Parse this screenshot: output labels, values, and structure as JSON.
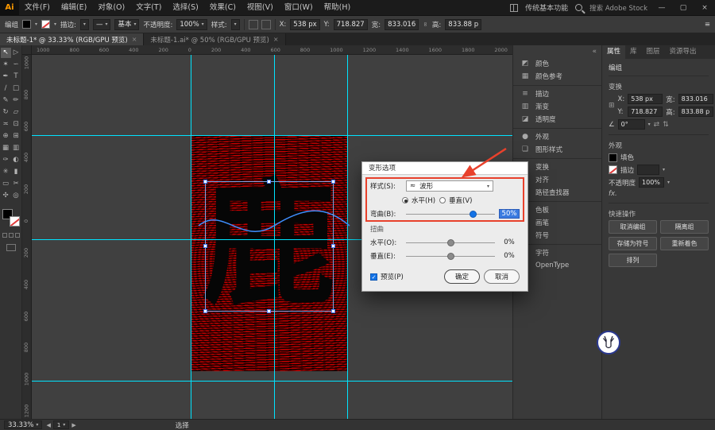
{
  "colors": {
    "accent_blue": "#1473e6",
    "guide_cyan": "#00e4ff",
    "artwork_red": "#c40000",
    "annotation_red": "#e8412c",
    "selection_blue": "#7aa7e8"
  },
  "icons": {
    "caret": "▾",
    "arrow_left": "◀",
    "arrow_right": "▶",
    "close": "×",
    "minimize": "—",
    "maximize": "▢",
    "collapse": "«",
    "check": "✓",
    "wave": "≈",
    "link": "∞",
    "angle": "∠",
    "ref_point": "⊞",
    "flip_h": "⇄",
    "flip_v": "⇅",
    "menu_burger": "≡"
  },
  "app": {
    "logo": "Ai",
    "menus": [
      {
        "name": "menu-file",
        "label": "文件(F)"
      },
      {
        "name": "menu-edit",
        "label": "编辑(E)"
      },
      {
        "name": "menu-object",
        "label": "对象(O)"
      },
      {
        "name": "menu-type",
        "label": "文字(T)"
      },
      {
        "name": "menu-select",
        "label": "选择(S)"
      },
      {
        "name": "menu-effect",
        "label": "效果(C)"
      },
      {
        "name": "menu-view",
        "label": "视图(V)"
      },
      {
        "name": "menu-window",
        "label": "窗口(W)"
      },
      {
        "name": "menu-help",
        "label": "帮助(H)"
      }
    ],
    "workspace": "传统基本功能",
    "stock_search": "搜索 Adobe Stock"
  },
  "control_bar": {
    "selection_label": "编组",
    "stroke_label": "描边:",
    "profile": "—",
    "brush": "基本",
    "opacity_label": "不透明度:",
    "opacity": "100%",
    "style_label": "样式:",
    "x_label": "X:",
    "x": "538 px",
    "y_label": "Y:",
    "y": "718.827",
    "w_label": "宽:",
    "w": "833.016",
    "h_label": "高:",
    "h": "833.88 p"
  },
  "tabs": [
    {
      "name": "tab-untitled-1",
      "title": "未标题-1* @ 33.33% (RGB/GPU 预览)",
      "active": true
    },
    {
      "name": "tab-untitled-1-ai",
      "title": "未标题-1.ai* @ 50% (RGB/GPU 预览)",
      "active": false
    }
  ],
  "toolbar": {
    "tools": [
      {
        "name": "selection-tool",
        "glyph": "↖",
        "active": true
      },
      {
        "name": "direct-selection-tool",
        "glyph": "▷"
      },
      {
        "name": "magic-wand-tool",
        "glyph": "✶"
      },
      {
        "name": "lasso-tool",
        "glyph": "∽"
      },
      {
        "name": "pen-tool",
        "glyph": "✒"
      },
      {
        "name": "type-tool",
        "glyph": "T"
      },
      {
        "name": "line-segment-tool",
        "glyph": "∕"
      },
      {
        "name": "rectangle-tool",
        "glyph": "□"
      },
      {
        "name": "paintbrush-tool",
        "glyph": "✎"
      },
      {
        "name": "pencil-tool",
        "glyph": "✏"
      },
      {
        "name": "rotate-tool",
        "glyph": "↻"
      },
      {
        "name": "scale-tool",
        "glyph": "▱"
      },
      {
        "name": "width-tool",
        "glyph": "≍"
      },
      {
        "name": "free-transform-tool",
        "glyph": "⊡"
      },
      {
        "name": "shape-builder-tool",
        "glyph": "⊕"
      },
      {
        "name": "perspective-grid-tool",
        "glyph": "⊞"
      },
      {
        "name": "mesh-tool",
        "glyph": "▦"
      },
      {
        "name": "gradient-tool",
        "glyph": "▥"
      },
      {
        "name": "eyedropper-tool",
        "glyph": "✑"
      },
      {
        "name": "blend-tool",
        "glyph": "◐"
      },
      {
        "name": "symbol-sprayer-tool",
        "glyph": "✳"
      },
      {
        "name": "column-graph-tool",
        "glyph": "▮"
      },
      {
        "name": "artboard-tool",
        "glyph": "▭"
      },
      {
        "name": "slice-tool",
        "glyph": "✂"
      },
      {
        "name": "hand-tool",
        "glyph": "✣"
      },
      {
        "name": "zoom-tool",
        "glyph": "◎"
      }
    ]
  },
  "rulers": {
    "top": [
      "1000",
      "800",
      "600",
      "400",
      "200",
      "0",
      "200",
      "400",
      "600",
      "800",
      "1000",
      "1200",
      "1400",
      "1600",
      "1800",
      "2000"
    ],
    "left": [
      "1000",
      "800",
      "600",
      "400",
      "200",
      "0",
      "200",
      "400",
      "600",
      "800",
      "1000",
      "1200"
    ]
  },
  "canvas": {
    "artwork_char": "鹿"
  },
  "dialog": {
    "title": "变形选项",
    "style_label": "样式(S):",
    "style_value": "波形",
    "radio_h": "水平(H)",
    "radio_v": "垂直(V)",
    "bend_label": "弯曲(B):",
    "bend_value": "50%",
    "distort_label": "扭曲",
    "horizontal_label": "水平(O):",
    "horizontal_value": "0%",
    "vertical_label": "垂直(E):",
    "vertical_value": "0%",
    "preview_label": "预览(P)",
    "ok_label": "确定",
    "cancel_label": "取消"
  },
  "dock": {
    "items": [
      {
        "name": "panel-color",
        "icon": "◩",
        "label": "颜色"
      },
      {
        "name": "panel-color-guide",
        "icon": "▦",
        "label": "颜色参考"
      },
      {
        "name": "panel-stroke",
        "icon": "≡",
        "label": "描边",
        "cls": "sep"
      },
      {
        "name": "panel-gradient",
        "icon": "▥",
        "label": "渐变"
      },
      {
        "name": "panel-transparency",
        "icon": "◪",
        "label": "透明度"
      },
      {
        "name": "panel-appearance",
        "icon": "●",
        "label": "外观",
        "cls": "sep"
      },
      {
        "name": "panel-graphic-styles",
        "icon": "❏",
        "label": "图形样式"
      },
      {
        "name": "panel-transform",
        "icon": "⊞",
        "label": "变换",
        "cls": "sep"
      },
      {
        "name": "panel-align",
        "icon": "≣",
        "label": "对齐"
      },
      {
        "name": "panel-pathfinder",
        "icon": "⧉",
        "label": "路径查找器"
      },
      {
        "name": "panel-swatches",
        "icon": "▤",
        "label": "色板",
        "cls": "sep"
      },
      {
        "name": "panel-brushes",
        "icon": "✎",
        "label": "画笔"
      },
      {
        "name": "panel-symbols",
        "icon": "✦",
        "label": "符号"
      },
      {
        "name": "panel-character",
        "icon": "A",
        "label": "字符",
        "cls": "sep"
      },
      {
        "name": "panel-opentype",
        "icon": "O",
        "label": "OpenType"
      }
    ]
  },
  "properties": {
    "tabs": [
      {
        "name": "tab-properties",
        "label": "属性",
        "active": true
      },
      {
        "name": "tab-libraries",
        "label": "库"
      },
      {
        "name": "tab-layers",
        "label": "图层"
      },
      {
        "name": "tab-asset-export",
        "label": "资源导出"
      }
    ],
    "selection_type": "编组",
    "transform_title": "变换",
    "transform": {
      "x_label": "X:",
      "x": "538 px",
      "y_label": "Y:",
      "y": "718.827 p",
      "w_label": "宽:",
      "w": "833.016",
      "h_label": "高:",
      "h": "833.88 p",
      "angle": "0°"
    },
    "appearance_title": "外观",
    "appearance": {
      "fill_label": "填色",
      "stroke_label": "描边",
      "opacity_label": "不透明度",
      "opacity": "100%",
      "fx": "fx."
    },
    "quick_title": "快速操作",
    "quick_buttons": [
      {
        "name": "ungroup-button",
        "label": "取消编组"
      },
      {
        "name": "isolate-group-button",
        "label": "隔离组"
      },
      {
        "name": "save-as-symbol-button",
        "label": "存储为符号"
      },
      {
        "name": "recolor-button",
        "label": "重新着色"
      },
      {
        "name": "arrange-button",
        "label": "排列"
      }
    ]
  },
  "status_bar": {
    "zoom": "33.33%",
    "artboard": "1",
    "tool": "选择"
  }
}
